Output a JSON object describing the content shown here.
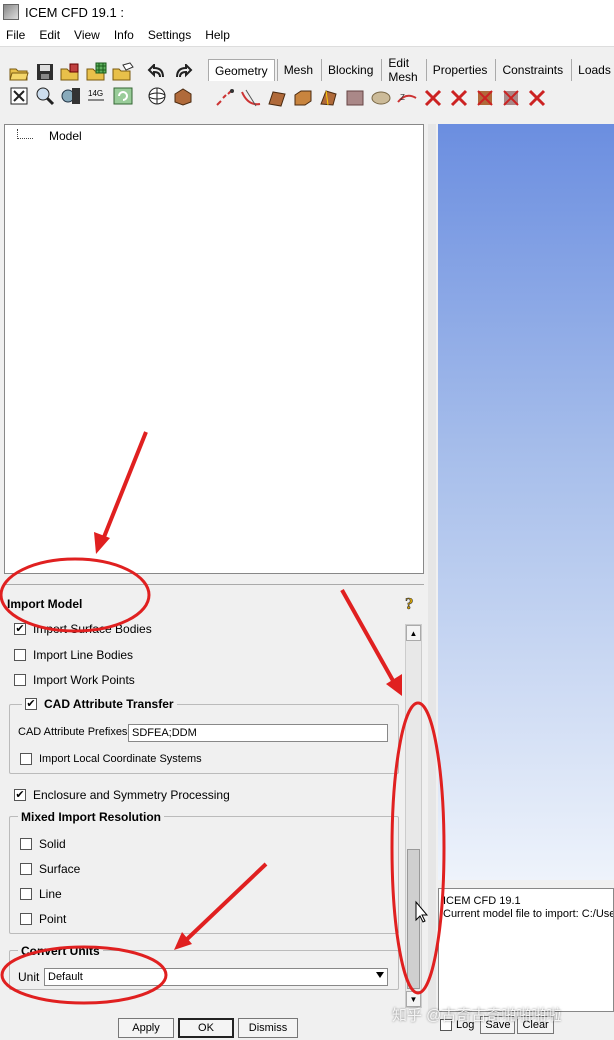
{
  "window": {
    "title": "ICEM CFD 19.1 :"
  },
  "menu": [
    "File",
    "Edit",
    "View",
    "Info",
    "Settings",
    "Help"
  ],
  "tabs": [
    "Geometry",
    "Mesh",
    "Blocking",
    "Edit Mesh",
    "Properties",
    "Constraints",
    "Loads"
  ],
  "tree": {
    "root_label": "Model"
  },
  "panel": {
    "title": "Import Model",
    "options": {
      "import_surface_bodies": "Import Surface Bodies",
      "import_line_bodies": "Import Line Bodies",
      "import_work_points": "Import Work Points"
    },
    "cad_attr": {
      "title": "CAD Attribute Transfer",
      "prefix_label": "CAD Attribute Prefixes",
      "prefix_value": "SDFEA;DDM",
      "local_coord_label": "Import Local Coordinate Systems"
    },
    "enclosure_label": "Enclosure and Symmetry Processing",
    "mixed": {
      "title": "Mixed Import Resolution",
      "items": [
        "Solid",
        "Surface",
        "Line",
        "Point"
      ]
    },
    "units": {
      "title": "Convert Units",
      "unit_label": "Unit",
      "unit_value": "Default"
    }
  },
  "buttons": {
    "apply": "Apply",
    "ok": "OK",
    "dismiss": "Dismiss"
  },
  "messages": {
    "line1": "ICEM CFD 19.1",
    "line2": "Current model file to import: C:/Users",
    "log_label": "Log",
    "save": "Save",
    "clear": "Clear"
  },
  "watermark": "知乎 @古奇古奇啪啪啪啦",
  "colors": {
    "annotation_red": "#e02020"
  }
}
